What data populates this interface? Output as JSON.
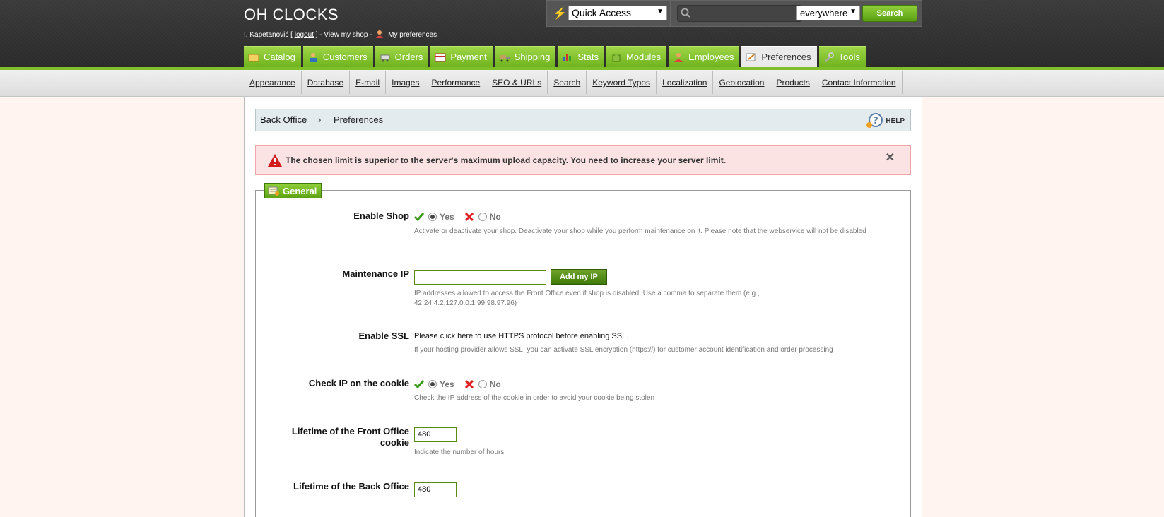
{
  "header": {
    "shop_name": "OH CLOCKS",
    "user_name": "I. Kapetanović",
    "logout_label": "logout",
    "view_shop_label": "View my shop",
    "preferences_label": "My preferences",
    "quick_access": "Quick Access",
    "search_scope": "everywhere",
    "search_button": "Search"
  },
  "tabs": [
    {
      "label": "Catalog",
      "icon": "folder-icon"
    },
    {
      "label": "Customers",
      "icon": "customers-icon"
    },
    {
      "label": "Orders",
      "icon": "cart-icon"
    },
    {
      "label": "Payment",
      "icon": "payment-icon"
    },
    {
      "label": "Shipping",
      "icon": "truck-icon"
    },
    {
      "label": "Stats",
      "icon": "chart-icon"
    },
    {
      "label": "Modules",
      "icon": "puzzle-icon"
    },
    {
      "label": "Employees",
      "icon": "employee-icon"
    },
    {
      "label": "Preferences",
      "icon": "preferences-icon"
    },
    {
      "label": "Tools",
      "icon": "wrench-icon"
    }
  ],
  "active_tab": "Preferences",
  "subtabs": [
    "Appearance",
    "Database",
    "E-mail",
    "Images",
    "Performance",
    "SEO & URLs",
    "Search",
    "Keyword Typos",
    "Localization",
    "Geolocation",
    "Products",
    "Contact Information"
  ],
  "breadcrumb": {
    "root": "Back Office",
    "leaf": "Preferences",
    "help": "HELP"
  },
  "error": {
    "message": "The chosen limit is superior to the server's maximum upload capacity. You need to increase your server limit."
  },
  "form": {
    "legend": "General",
    "enable_shop": {
      "label": "Enable Shop",
      "yes": "Yes",
      "no": "No",
      "selected": "Yes",
      "hint": "Activate or deactivate your shop. Deactivate your shop while you perform maintenance on it. Please note that the webservice will not be disabled"
    },
    "maintenance_ip": {
      "label": "Maintenance IP",
      "value": "",
      "button": "Add my IP",
      "hint": "IP addresses allowed to access the Front Office even if shop is disabled. Use a comma to separate them (e.g., 42.24.4.2,127.0.0.1,99.98.97.96)"
    },
    "enable_ssl": {
      "label": "Enable SSL",
      "text": "Please click here to use HTTPS protocol before enabling SSL.",
      "hint": "If your hosting provider allows SSL, you can activate SSL encryption (https://) for customer account identification and order processing"
    },
    "check_ip_cookie": {
      "label": "Check IP on the cookie",
      "yes": "Yes",
      "no": "No",
      "selected": "Yes",
      "hint": "Check the IP address of the cookie in order to avoid your cookie being stolen"
    },
    "front_cookie": {
      "label": "Lifetime of the Front Office cookie",
      "value": "480",
      "hint": "Indicate the number of hours"
    },
    "back_cookie": {
      "label": "Lifetime of the Back Office",
      "value": "480"
    }
  },
  "colors": {
    "accent_green": "#7fbf2a",
    "header_bg": "#323232",
    "error_bg": "#fbe3e4"
  }
}
